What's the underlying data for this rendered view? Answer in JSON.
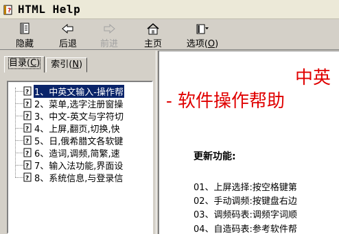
{
  "window": {
    "title": "HTML Help"
  },
  "toolbar": {
    "hide": "隐藏",
    "back": "后退",
    "forward": "前进",
    "home": "主页",
    "options_pre": "选项(",
    "options_key": "O",
    "options_post": ")"
  },
  "tabs": {
    "contents_pre": "目录(",
    "contents_key": "C",
    "contents_post": ")",
    "index_pre": "索引(",
    "index_key": "N",
    "index_post": ")"
  },
  "tree": {
    "items": [
      {
        "label": "1、中英文输入-操作帮"
      },
      {
        "label": "2、菜单,选字注册窗操"
      },
      {
        "label": "3、中文-英文与字符切"
      },
      {
        "label": "4、上屏,翻页,切换,快"
      },
      {
        "label": "5、日,俄希腊文各软键"
      },
      {
        "label": "6、造词,调频,简繁,速"
      },
      {
        "label": "7、输入法功能,界面设"
      },
      {
        "label": "8、系统信息,与登录信"
      }
    ]
  },
  "content": {
    "heading1": "中英",
    "heading2": "- 软件操作帮助",
    "section_title": "更新功能:",
    "lines": [
      "01、上屏选择:按空格键第",
      "02、手动调频:按键盘右边",
      "03、调频码表:调频字词顺",
      "04、自造码表:参考软件帮"
    ]
  },
  "colors": {
    "accent_red": "#e00000",
    "selection_blue": "#0a246a",
    "chrome": "#d4d0c8"
  }
}
